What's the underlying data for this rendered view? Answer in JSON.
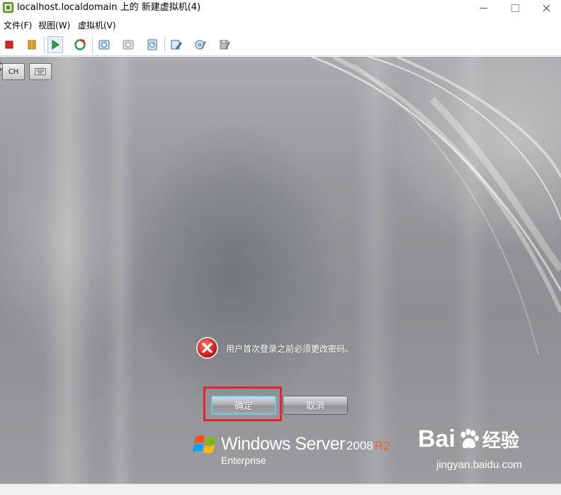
{
  "window": {
    "title": "localhost.localdomain 上的 新建虚拟机(4)",
    "controls": {
      "minimize": "minimize",
      "maximize": "maximize",
      "close": "close"
    }
  },
  "menu": {
    "items": [
      {
        "label": "文件(F)"
      },
      {
        "label": "视图(W)"
      },
      {
        "label": "虚拟机(V)"
      }
    ]
  },
  "toolbar": {
    "buttons": [
      {
        "icon": "stop-icon",
        "color": "#d9281f"
      },
      {
        "icon": "pause-icon",
        "color": "#f0a018"
      },
      {
        "icon": "play-icon",
        "color": "#2ea043",
        "state": "active"
      },
      {
        "icon": "reset-icon",
        "color": "#d9281f"
      },
      {
        "icon": "snapshot-icon"
      },
      {
        "icon": "revert-snapshot-icon"
      },
      {
        "icon": "manage-snapshots-icon"
      },
      {
        "icon": "edit-settings-icon"
      },
      {
        "icon": "cd-dvd-icon"
      },
      {
        "icon": "floppy-icon"
      }
    ]
  },
  "vm_toolbar": {
    "lang_label": "CH",
    "keyboard_icon": "keyboard-icon"
  },
  "dialog": {
    "message": "用户首次登录之前必须更改密码。",
    "ok_label": "确定",
    "cancel_label": "取消",
    "error_color": "#d62a2a",
    "highlight_color": "#e3232f"
  },
  "branding": {
    "product": "Windows Server",
    "year": "2008",
    "release": "R2",
    "edition": "Enterprise"
  },
  "watermark": {
    "logo_left": "Bai",
    "logo_right": "经验",
    "site": "jingyan.baidu.com"
  }
}
